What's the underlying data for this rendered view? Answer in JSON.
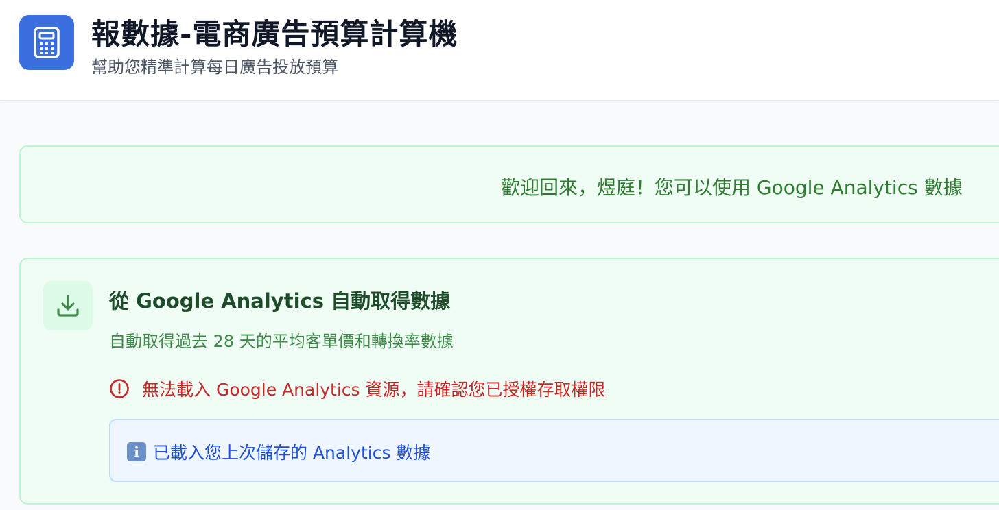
{
  "header": {
    "title": "報數據-電商廣告預算計算機",
    "subtitle": "幫助您精準計算每日廣告投放預算",
    "logo_icon": "calculator-icon"
  },
  "welcome": {
    "message": "歡迎回來，煜庭！您可以使用 Google Analytics 數據"
  },
  "analytics_card": {
    "icon": "download-icon",
    "title": "從 Google Analytics 自動取得數據",
    "description": "自動取得過去 28 天的平均客單價和轉換率數據",
    "error_icon": "alert-circle-icon",
    "error_message": "無法載入 Google Analytics 資源，請確認您已授權存取權限",
    "info_icon": "info-icon",
    "info_glyph": "i",
    "info_message": "已載入您上次儲存的 Analytics 數據"
  },
  "colors": {
    "brand": "#3b6fe0",
    "success_bg": "#f0fdf4",
    "success_border": "#bbf7d0",
    "success_text": "#2e7d32",
    "error_text": "#c62828",
    "info_bg": "#eff6ff",
    "info_text": "#1d4ed8"
  }
}
